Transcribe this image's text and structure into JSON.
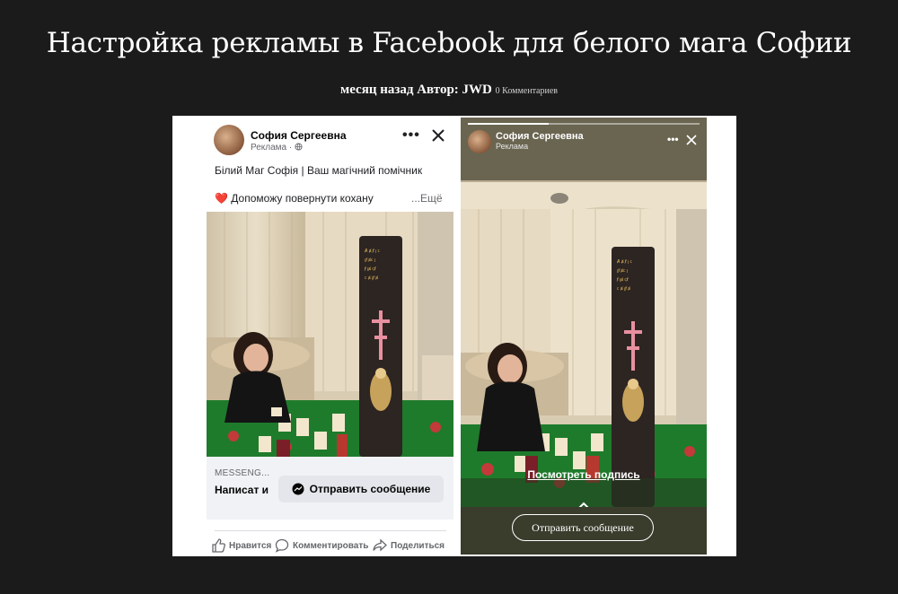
{
  "article": {
    "title": "Настройка рекламы в Facebook для белого мага Софии",
    "date": "месяц назад",
    "author_label": "Автор:",
    "author": "JWD",
    "comments": "0 Комментариев"
  },
  "feed_post": {
    "page_name": "София Сергеевна",
    "sponsored": "Реклама · ",
    "line1": "Білий Маг Софія | Ваш магічний помічник",
    "heart": "❤️",
    "line2": "Допоможу повернути кохану",
    "see_more": "...Ещё",
    "cta_source": "MESSENG...",
    "cta_write": "Написат и",
    "cta_button": "Отправить сообщение",
    "actions": {
      "like": "Нравится",
      "comment": "Комментировать",
      "share": "Поделиться"
    }
  },
  "story": {
    "page_name": "София Сергеевна",
    "sponsored": "Реклама",
    "caption_link": "Посмотреть подпись",
    "send_button": "Отправить сообщение"
  },
  "icons": [
    "more-icon",
    "close-icon",
    "globe-icon",
    "messenger-icon",
    "like-icon",
    "comment-icon",
    "share-icon",
    "chevron-up-icon"
  ]
}
